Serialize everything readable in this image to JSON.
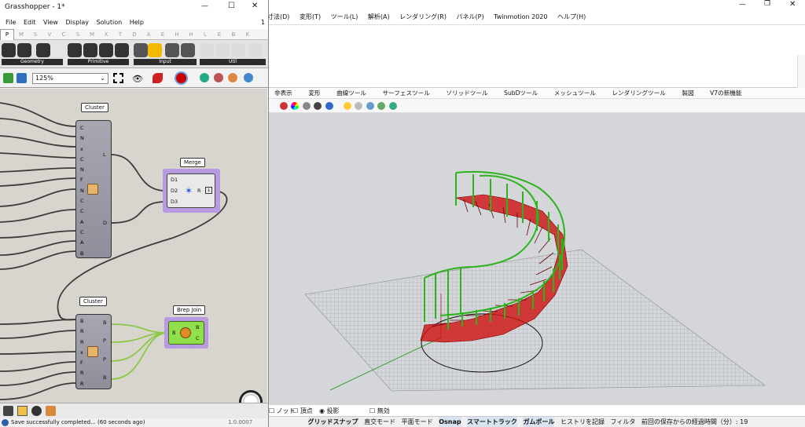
{
  "gh": {
    "title": "Grasshopper - 1*",
    "title_right": "1",
    "menu": [
      "File",
      "Edit",
      "View",
      "Display",
      "Solution",
      "Help"
    ],
    "cattabs": [
      "P",
      "M",
      "S",
      "V",
      "C",
      "S",
      "M",
      "X",
      "T",
      "D",
      "A",
      "E",
      "H",
      "H",
      "L",
      "E",
      "B",
      "K",
      "K",
      "L"
    ],
    "ribbon_groups": [
      "Geometry",
      "Primitive",
      "Input",
      "Util"
    ],
    "zoom": "125%",
    "canvas": {
      "cluster1": {
        "title": "Cluster",
        "inputs": [
          "C",
          "N",
          "x",
          "C",
          "N",
          "F",
          "N",
          "C",
          "C",
          "A",
          "C",
          "A",
          "B"
        ],
        "outputs": [
          "L",
          "D"
        ]
      },
      "merge": {
        "title": "Merge",
        "inputs": [
          "D1",
          "D2",
          "D3"
        ],
        "output": "R"
      },
      "cluster2": {
        "title": "Cluster",
        "inputs": [
          "B",
          "R",
          "R",
          "x",
          "F",
          "R",
          "R"
        ],
        "outputs": [
          "B",
          "P",
          "P",
          "B"
        ]
      },
      "brepjoin": {
        "title": "Brep Join",
        "input": "B",
        "outputs": [
          "B",
          "C"
        ]
      }
    },
    "status": "Save successfully completed... (60 seconds ago)",
    "version": "1.0.0007"
  },
  "rhino": {
    "menu": [
      "寸法(D)",
      "変形(T)",
      "ツール(L)",
      "解析(A)",
      "レンダリング(R)",
      "パネル(P)",
      "Twinmotion 2020",
      "ヘルプ(H)"
    ],
    "tabs": [
      "非表示",
      "変形",
      "曲線ツール",
      "サーフェスツール",
      "ソリッドツール",
      "SubDツール",
      "メッシュツール",
      "レンダリングツール",
      "製図",
      "V7の新機能"
    ],
    "osnap": [
      "ノット",
      "頂点",
      "投影",
      "無効"
    ],
    "status": [
      "グリッドスナップ",
      "直交モード",
      "平面モード",
      "Osnap",
      "スマートトラック",
      "ガムボール",
      "ヒストリを記録",
      "フィルタ",
      "前回の保存からの経過時間（分）: 19"
    ],
    "colors": {
      "stair_red": "#d01010",
      "rail_green": "#29b81a",
      "viewport_bg": "#d4d6da"
    }
  }
}
